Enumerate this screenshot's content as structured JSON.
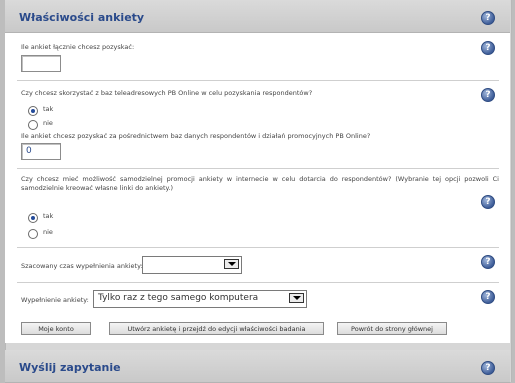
{
  "panel1": {
    "title": "Właściwości ankiety",
    "help": "?"
  },
  "q1": {
    "label": "Ile ankiet łącznie chcesz pozyskać:",
    "value": ""
  },
  "q2": {
    "label": "Czy chcesz skorzystać z baz teleadresowych PB Online w celu pozyskania respondentów?",
    "opt_yes": "tak",
    "opt_no": "nie",
    "selected": "tak"
  },
  "q3": {
    "label": "Ile ankiet chcesz pozyskać za pośrednictwem baz danych respondentów i działań promocyjnych PB Online?",
    "value": "0"
  },
  "q4": {
    "label": "Czy chcesz mieć możliwość samodzielnej promocji ankiety w internecie w celu dotarcia do respondentów? (Wybranie tej opcji pozwoli Ci samodzielnie kreować własne linki do ankiety.)",
    "opt_yes": "tak",
    "opt_no": "nie",
    "selected": "tak"
  },
  "q5": {
    "label": "Szacowany czas wypełnienia ankiety:",
    "value": ""
  },
  "q6": {
    "label": "Wypełnienie ankiety:",
    "value": "Tylko raz z tego samego komputera"
  },
  "buttons": {
    "my_account": "Moje konto",
    "create": "Utwórz ankietę i przejdź do edycji właściwości badania",
    "home": "Powrót do strony głównej"
  },
  "panel2": {
    "title": "Wyślij zapytanie",
    "help": "?"
  },
  "colors": {
    "accent": "#2a4a8b",
    "panel_bg": "#d6d6d6"
  }
}
